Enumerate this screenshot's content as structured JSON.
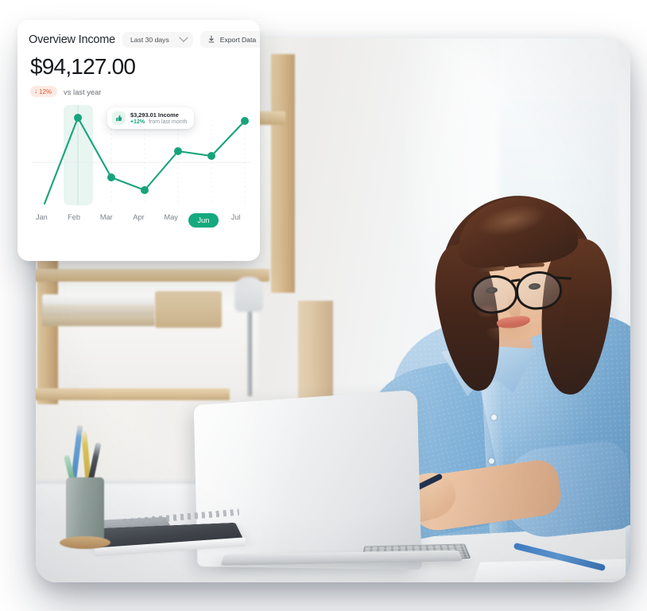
{
  "card": {
    "title": "Overview Income",
    "range_label": "Last 30 days",
    "range_icon": "chevron-down-icon",
    "export_label": "Export Data",
    "export_icon": "download-icon",
    "amount": "$94,127.00",
    "delta_badge": "12%",
    "delta_arrow": "↓",
    "delta_note": "vs last year",
    "delta_color": "#e2562c",
    "accent_color": "#15a97f"
  },
  "tooltip": {
    "icon": "thumbs-up-icon",
    "amount_label": "$3,293.01 Income",
    "percent": "+12%",
    "subtext": "from last month"
  },
  "chart_data": {
    "type": "line",
    "title": "Overview Income",
    "categories": [
      "Jan",
      "Feb",
      "Mar",
      "Apr",
      "May",
      "Jun",
      "Jul"
    ],
    "values": [
      8,
      96,
      42,
      27,
      62,
      57,
      90
    ],
    "active_category": "Jun",
    "highlight_category": "Feb",
    "line_color": "#15a97f",
    "point_color": "#15a97f",
    "grid": true,
    "xlabel": "",
    "ylabel": "",
    "ylim": [
      0,
      100
    ],
    "legend": "none",
    "annotations": [
      {
        "at": "Feb",
        "text": "$3,293.01 Income",
        "secondary": "+12% from last month"
      }
    ]
  },
  "photo": {
    "alt": "Woman with glasses working on a laptop at a bright office desk"
  }
}
